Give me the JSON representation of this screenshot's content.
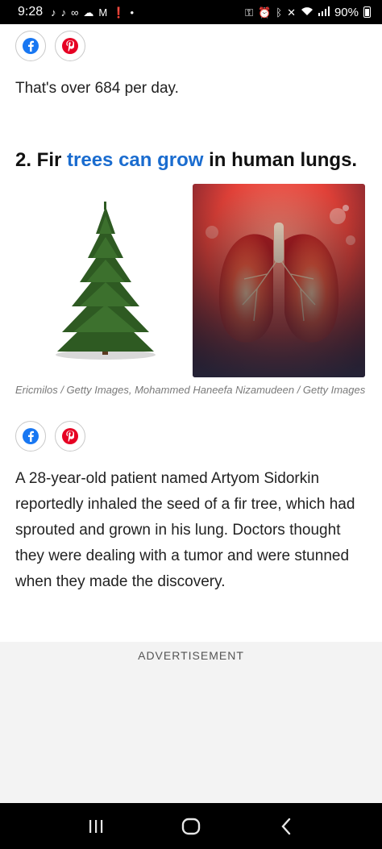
{
  "status_bar": {
    "time": "9:28",
    "battery": "90%",
    "left_icons": [
      "tiktok-icon",
      "tiktok-icon",
      "voicemail-icon",
      "cloud-icon",
      "gmail-icon",
      "alert-icon",
      "dot-icon"
    ],
    "right_icons": [
      "key-icon",
      "alarm-icon",
      "bluetooth-icon",
      "mute-icon",
      "wifi-icon",
      "signal-icon",
      "battery-icon"
    ]
  },
  "share": {
    "facebook_icon": "facebook-icon",
    "pinterest_icon": "pinterest-icon"
  },
  "article": {
    "fact_1_text": "That's over 684 per day.",
    "fact_2_number": "2. Fir ",
    "fact_2_link": "trees can grow",
    "fact_2_rest": " in human lungs.",
    "image_caption": "Ericmilos / Getty Images, Mohammed Haneefa Nizamudeen / Getty Images",
    "fact_2_body": "A 28-year-old patient named Artyom Sidorkin reportedly inhaled the seed of a fir tree, which had sprouted and grown in his lung. Doctors thought they were dealing with a tumor and were stunned when they made the discovery."
  },
  "advertisement": {
    "label": "ADVERTISEMENT"
  },
  "colors": {
    "link": "#1a6ccf",
    "facebook": "#1877f2",
    "pinterest": "#e60023"
  }
}
